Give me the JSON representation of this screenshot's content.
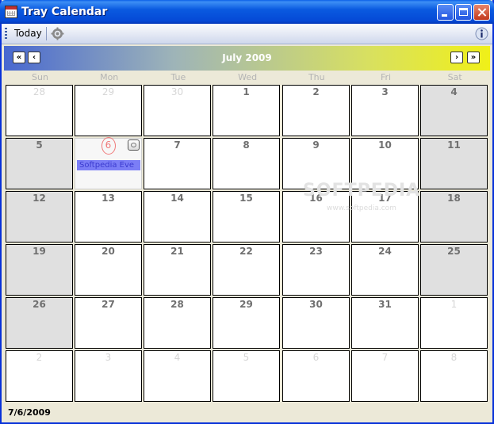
{
  "window": {
    "title": "Tray Calendar"
  },
  "toolbar": {
    "today_label": "Today"
  },
  "header": {
    "month_title": "July 2009"
  },
  "day_names": [
    "Sun",
    "Mon",
    "Tue",
    "Wed",
    "Thu",
    "Fri",
    "Sat"
  ],
  "weeks": [
    [
      "28",
      "29",
      "30",
      "1",
      "2",
      "3",
      "4"
    ],
    [
      "5",
      "6",
      "7",
      "8",
      "9",
      "10",
      "11"
    ],
    [
      "12",
      "13",
      "14",
      "15",
      "16",
      "17",
      "18"
    ],
    [
      "19",
      "20",
      "21",
      "22",
      "23",
      "24",
      "25"
    ],
    [
      "26",
      "27",
      "28",
      "29",
      "30",
      "31",
      "1"
    ],
    [
      "2",
      "3",
      "4",
      "5",
      "6",
      "7",
      "8"
    ]
  ],
  "events": {
    "jul6": "Softpedia Eve"
  },
  "watermark": {
    "text": "SOFTPEDIA",
    "url": "www.softpedia.com"
  },
  "status": {
    "selected_date": "7/6/2009"
  },
  "colors": {
    "weekend": "#e0e0e0",
    "event": "#7b7ef6",
    "today_ring": "#f07a7a"
  }
}
